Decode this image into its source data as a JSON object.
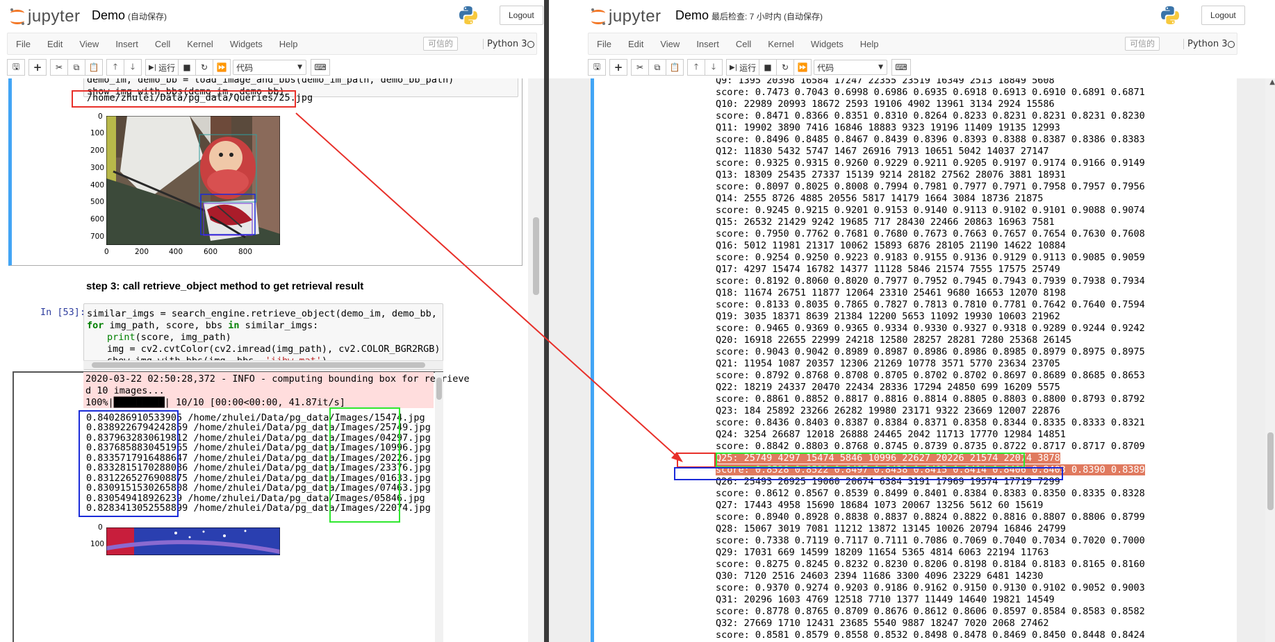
{
  "app": {
    "logo_text": "jupyter",
    "logout_label": "Logout",
    "trusted_label": "可信的",
    "kernel_name": "Python 3",
    "menu": [
      "File",
      "Edit",
      "View",
      "Insert",
      "Cell",
      "Kernel",
      "Widgets",
      "Help"
    ],
    "toolbar": {
      "run_label": "运行",
      "cell_type": "代码"
    },
    "brand_color": "#f37726",
    "selected_cell_color": "#42a5f5",
    "prompt_color": "#303f9f"
  },
  "left": {
    "title": "Demo",
    "status": "(自动保存)",
    "cell1_code": [
      "demo_im, demo_bb = load_image_and_bbs(demo_im_path, demo_bb_path)",
      "show_img_with_bbs(demo_im, demo_bb)"
    ],
    "cell1_output": "/home/zhulei/Data/pg_data/Queries/25.jpg",
    "plot_y_ticks": [
      "0",
      "100",
      "200",
      "300",
      "400",
      "500",
      "600",
      "700"
    ],
    "plot_x_ticks": [
      "0",
      "200",
      "400",
      "600",
      "800"
    ],
    "heading": "step 3: call retrieve_object method to get retrieval result",
    "cell2_prompt": "In [53]:",
    "cell2_code": {
      "l1a": "similar_imgs = search_engine.retrieve_object(demo_im, demo_bb, top_k=",
      "l1b": "10",
      "l2_for": "for",
      "l2_mid": " img_path, score, bbs ",
      "l2_in": "in",
      "l2_end": " similar_imgs:",
      "l3_print": "print",
      "l3_end": "(score, img_path)",
      "l4": "img = cv2.cvtColor(cv2.imread(img_path), cv2.COLOR_BGR2RGB)",
      "l5a": "show_img_with_bbs(img, bbs, ",
      "l5b": "'ijhw_mat'",
      "l5c": ")"
    },
    "stderr_lines": [
      "2020-03-22 02:50:28,372 - INFO - computing bounding box for retrieve",
      "d 10 images...",
      "100%|█████████| 10/10 [00:00<00:00, 41.87it/s]"
    ],
    "results": [
      {
        "score": "0.840286910533905",
        "path": "/home/zhulei/Data/pg_data/Images/15474.jpg"
      },
      {
        "score": "0.8389226794242859",
        "path": "/home/zhulei/Data/pg_data/Images/25749.jpg"
      },
      {
        "score": "0.8379632830619812",
        "path": "/home/zhulei/Data/pg_data/Images/04297.jpg"
      },
      {
        "score": "0.8376858830451965",
        "path": "/home/zhulei/Data/pg_data/Images/10996.jpg"
      },
      {
        "score": "0.8335717916488647",
        "path": "/home/zhulei/Data/pg_data/Images/20226.jpg"
      },
      {
        "score": "0.8332815170288086",
        "path": "/home/zhulei/Data/pg_data/Images/23376.jpg"
      },
      {
        "score": "0.8312265276908875",
        "path": "/home/zhulei/Data/pg_data/Images/01633.jpg"
      },
      {
        "score": "0.8309151530265808",
        "path": "/home/zhulei/Data/pg_data/Images/07463.jpg"
      },
      {
        "score": "0.830549418926239",
        "path": "/home/zhulei/Data/pg_data/Images/05846.jpg"
      },
      {
        "score": "0.8283413052558899",
        "path": "/home/zhulei/Data/pg_data/Images/22074.jpg"
      }
    ],
    "plot2_y_tick": "0",
    "plot2_y_tick2": "100"
  },
  "right": {
    "title": "Demo",
    "status": "最后检查: 7 小时内  (自动保存)",
    "lines": [
      "Q9: 1395 20398 16584 17247 22355 23519 16349 2513 18849 5608",
      "score: 0.7473 0.7043 0.6998 0.6986 0.6935 0.6918 0.6913 0.6910 0.6891 0.6871",
      "Q10: 22989 20993 18672 2593 19106 4902 13961 3134 2924 15586",
      "score: 0.8471 0.8366 0.8351 0.8310 0.8264 0.8233 0.8231 0.8231 0.8231 0.8230",
      "Q11: 19902 3890 7416 16846 18883 9323 19196 11409 19135 12993",
      "score: 0.8496 0.8485 0.8467 0.8439 0.8396 0.8393 0.8388 0.8387 0.8386 0.8383",
      "Q12: 11830 5432 5747 1467 26916 7913 10651 5042 14037 27147",
      "score: 0.9325 0.9315 0.9260 0.9229 0.9211 0.9205 0.9197 0.9174 0.9166 0.9149",
      "Q13: 18309 25435 27337 15139 9214 28182 27562 28076 3881 18931",
      "score: 0.8097 0.8025 0.8008 0.7994 0.7981 0.7977 0.7971 0.7958 0.7957 0.7956",
      "Q14: 2555 8726 4885 20556 5817 14179 1664 3084 18736 21875",
      "score: 0.9245 0.9215 0.9201 0.9153 0.9140 0.9113 0.9102 0.9101 0.9088 0.9074",
      "Q15: 26532 21429 9242 19685 717 28430 22466 20863 16963 7581",
      "score: 0.7950 0.7762 0.7681 0.7680 0.7673 0.7663 0.7657 0.7654 0.7630 0.7608",
      "Q16: 5012 11981 21317 10062 15893 6876 28105 21190 14622 10884",
      "score: 0.9254 0.9250 0.9223 0.9183 0.9155 0.9136 0.9129 0.9113 0.9085 0.9059",
      "Q17: 4297 15474 16782 14377 11128 5846 21574 7555 17575 25749",
      "score: 0.8192 0.8060 0.8020 0.7977 0.7952 0.7945 0.7943 0.7939 0.7938 0.7934",
      "Q18: 11674 26751 11877 12064 23310 25461 9680 16653 12070 8198",
      "score: 0.8133 0.8035 0.7865 0.7827 0.7813 0.7810 0.7781 0.7642 0.7640 0.7594",
      "Q19: 3035 18371 8639 21384 12200 5653 11092 19930 10603 21962",
      "score: 0.9465 0.9369 0.9365 0.9334 0.9330 0.9327 0.9318 0.9289 0.9244 0.9242",
      "Q20: 16918 22655 22999 24218 12580 28257 28281 7280 25368 26145",
      "score: 0.9043 0.9042 0.8989 0.8987 0.8986 0.8986 0.8985 0.8979 0.8975 0.8975",
      "Q21: 11954 1087 20357 12306 21269 10778 3571 5770 23634 23705",
      "score: 0.8792 0.8768 0.8708 0.8705 0.8702 0.8702 0.8697 0.8689 0.8685 0.8653",
      "Q22: 18219 24337 20470 22434 28336 17294 24850 699 16209 5575",
      "score: 0.8861 0.8852 0.8817 0.8816 0.8814 0.8805 0.8803 0.8800 0.8793 0.8792",
      "Q23: 184 25892 23266 26282 19980 23171 9322 23669 12007 22876",
      "score: 0.8436 0.8403 0.8387 0.8384 0.8371 0.8358 0.8344 0.8335 0.8333 0.8321",
      "Q24: 3254 26687 12018 26888 24465 2042 11713 17770 12984 14851",
      "score: 0.8842 0.8803 0.8768 0.8745 0.8739 0.8735 0.8722 0.8717 0.8717 0.8709",
      "Q25: 25749 4297 15474 5846 10996 22627 20226 21574 22074 3878",
      "score: 0.8528 0.8522 0.8497 0.8438 0.8415 0.8414 0.8406 0.8403 0.8390 0.8389",
      "Q26: 25493 26925 19060 20674 6384 3191 17969 19574 17719 7299",
      "score: 0.8612 0.8567 0.8539 0.8499 0.8401 0.8384 0.8383 0.8350 0.8335 0.8328",
      "Q27: 17443 4958 15690 18684 1073 20067 13256 5612 60 15619",
      "score: 0.8940 0.8928 0.8838 0.8837 0.8824 0.8822 0.8816 0.8807 0.8806 0.8799",
      "Q28: 15067 3019 7081 11212 13872 13145 10026 20794 16846 24799",
      "score: 0.7338 0.7119 0.7117 0.7111 0.7086 0.7069 0.7040 0.7034 0.7020 0.7000",
      "Q29: 17031 669 14599 18209 11654 5365 4814 6063 22194 11763",
      "score: 0.8275 0.8245 0.8232 0.8230 0.8206 0.8198 0.8184 0.8183 0.8165 0.8160",
      "Q30: 7120 2516 24603 2394 11686 3300 4096 23229 6481 14230",
      "score: 0.9370 0.9274 0.9203 0.9186 0.9162 0.9150 0.9130 0.9102 0.9052 0.9003",
      "Q31: 20296 1603 4769 12518 7710 1377 11449 14640 19821 14549",
      "score: 0.8778 0.8765 0.8709 0.8676 0.8612 0.8606 0.8597 0.8584 0.8583 0.8582",
      "Q32: 27669 1710 12431 23685 5540 9887 18247 7020 2068 27462",
      "score: 0.8581 0.8579 0.8558 0.8532 0.8498 0.8478 0.8469 0.8450 0.8448 0.8424"
    ],
    "highlight_line_index": 32,
    "highlight_score_index": 33
  }
}
